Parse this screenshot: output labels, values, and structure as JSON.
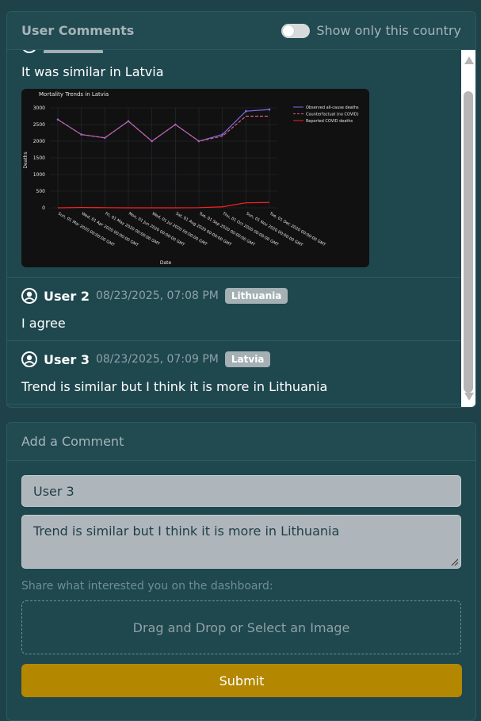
{
  "comments_section": {
    "title": "User Comments",
    "toggle_label": "Show only this country",
    "comments": [
      {
        "text": "It was similar in Latvia",
        "chart_title": "Mortality Trends in Latvia"
      },
      {
        "user": "User 2",
        "date": "08/23/2025, 07:08 PM",
        "country": "Lithuania",
        "text": "I agree"
      },
      {
        "user": "User 3",
        "date": "08/23/2025, 07:09 PM",
        "country": "Latvia",
        "text": "Trend is similar but I think it is more in Lithuania"
      }
    ]
  },
  "chart_data": {
    "type": "line",
    "title": "Mortality Trends in Latvia",
    "xlabel": "Date",
    "ylabel": "Deaths",
    "ylim": [
      0,
      3000
    ],
    "yticks": [
      0,
      500,
      1000,
      1500,
      2000,
      2500,
      3000
    ],
    "categories": [
      "Sun, 01 Mar 2020 00:00:00 GMT",
      "Wed, 01 Apr 2020 00:00:00 GMT",
      "Fri, 01 May 2020 00:00:00 GMT",
      "Mon, 01 Jun 2020 00:00:00 GMT",
      "Wed, 01 Jul 2020 00:00:00 GMT",
      "Sat, 01 Aug 2020 00:00:00 GMT",
      "Tue, 01 Sep 2020 00:00:00 GMT",
      "Thu, 01 Oct 2020 00:00:00 GMT",
      "Sun, 01 Nov 2020 00:00:00 GMT",
      "Tue, 01 Dec 2020 00:00:00 GMT"
    ],
    "series": [
      {
        "name": "Observed all-cause deaths",
        "color": "#7b6ee6",
        "dash": "solid",
        "values": [
          2650,
          2200,
          2100,
          2600,
          2000,
          2500,
          2000,
          2200,
          2900,
          2950
        ]
      },
      {
        "name": "Counterfactual (no COVID)",
        "color": "#e05a8a",
        "dash": "dash",
        "values": [
          2650,
          2200,
          2100,
          2600,
          2000,
          2500,
          2000,
          2150,
          2750,
          2750
        ]
      },
      {
        "name": "Reported COVID deaths",
        "color": "#ff2020",
        "dash": "solid",
        "values": [
          0,
          10,
          5,
          0,
          0,
          0,
          5,
          30,
          150,
          160
        ]
      }
    ],
    "grid": true,
    "legend": "top-right"
  },
  "add_comment": {
    "title": "Add a Comment",
    "name_value": "User 3",
    "comment_value": "Trend is similar but I think it is more in Lithuania",
    "hint": "Share what interested you on the dashboard:",
    "dropzone_label": "Drag and Drop or Select an Image",
    "submit_label": "Submit"
  }
}
